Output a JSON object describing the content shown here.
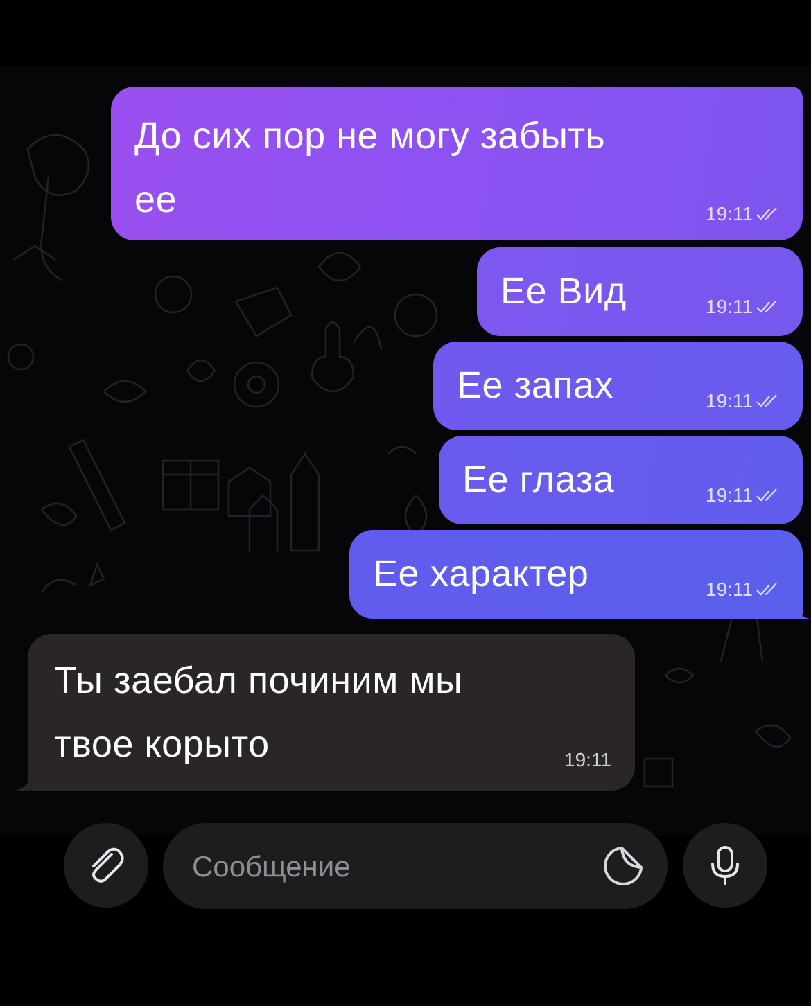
{
  "chat": {
    "messages": [
      {
        "direction": "outgoing",
        "text_lines": [
          "До сих пор не могу забыть",
          "ее"
        ],
        "time": "19:11",
        "status": "read"
      },
      {
        "direction": "outgoing",
        "text": "Ее Вид",
        "time": "19:11",
        "status": "read"
      },
      {
        "direction": "outgoing",
        "text": "Ее запах",
        "time": "19:11",
        "status": "read"
      },
      {
        "direction": "outgoing",
        "text": "Ее глаза",
        "time": "19:11",
        "status": "read"
      },
      {
        "direction": "outgoing",
        "text": "Ее характер",
        "time": "19:11",
        "status": "read"
      },
      {
        "direction": "incoming",
        "text_lines": [
          "Ты заебал починим мы",
          "твое корыто"
        ],
        "time": "19:11"
      }
    ]
  },
  "composer": {
    "placeholder": "Сообщение",
    "attach_icon": "paperclip-icon",
    "sticker_icon": "sticker-icon",
    "mic_icon": "microphone-icon"
  },
  "colors": {
    "outgoing_top": "#9a4ff0",
    "outgoing_bottom": "#5a5fec",
    "incoming": "#2a2628",
    "background": "#000000"
  }
}
